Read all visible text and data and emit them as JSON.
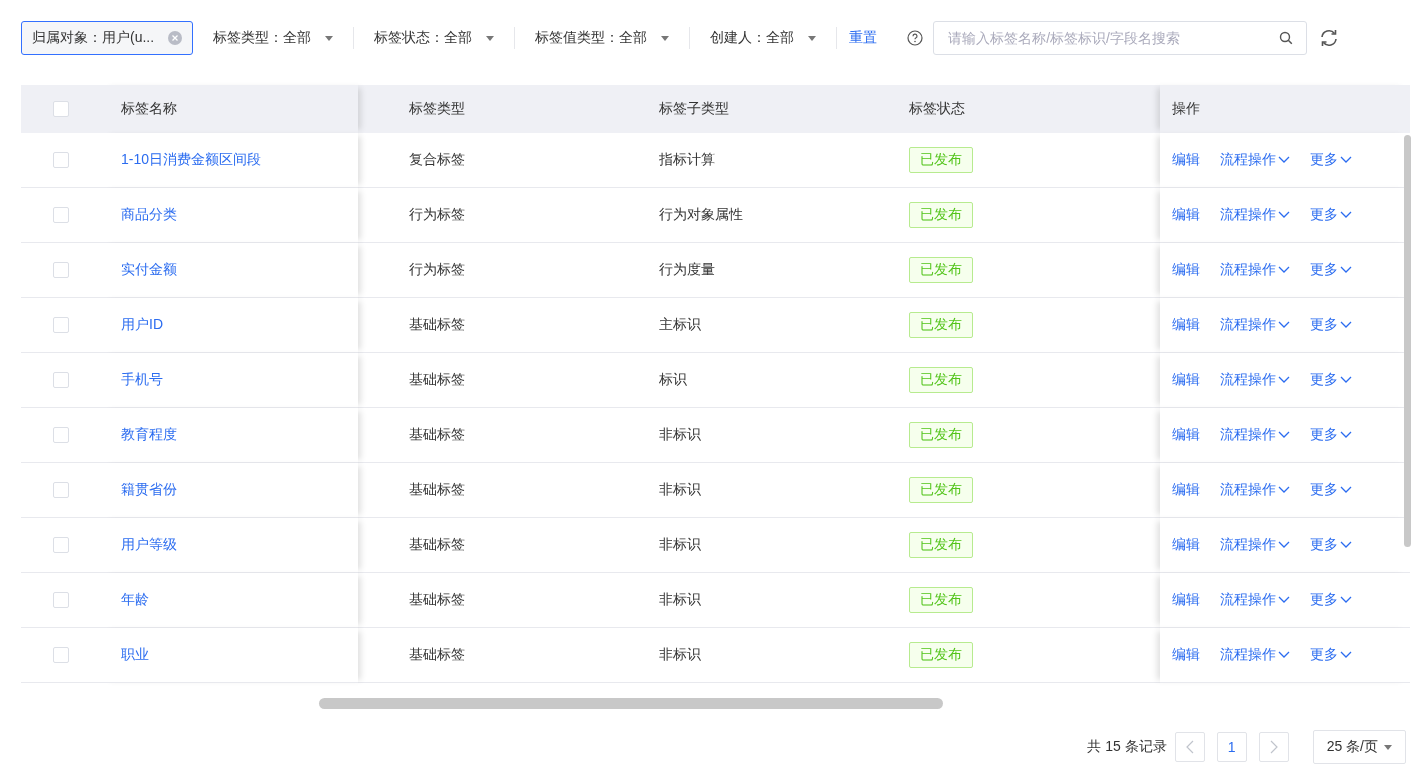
{
  "filters": {
    "owner_chip": {
      "label": "归属对象：用户(u..."
    },
    "selects": [
      {
        "label": "标签类型：全部"
      },
      {
        "label": "标签状态：全部"
      },
      {
        "label": "标签值类型：全部"
      },
      {
        "label": "创建人：全部"
      }
    ],
    "reset_link": "重置",
    "search": {
      "placeholder": "请输入标签名称/标签标识/字段名搜索"
    }
  },
  "table": {
    "header_checkbox": {
      "checked": false
    },
    "columns": [
      "标签名称",
      "标签类型",
      "标签子类型",
      "标签状态",
      "操作"
    ],
    "rows": [
      {
        "checked": false,
        "name": "1-10日消费金额区间段",
        "type": "复合标签",
        "subtype": "指标计算",
        "status": "已发布",
        "actions": [
          {
            "label": "编辑",
            "menu": false
          },
          {
            "label": "流程操作",
            "menu": true
          },
          {
            "label": "更多",
            "menu": true
          }
        ]
      },
      {
        "checked": false,
        "name": "商品分类",
        "type": "行为标签",
        "subtype": "行为对象属性",
        "status": "已发布",
        "actions": [
          {
            "label": "编辑",
            "menu": false
          },
          {
            "label": "流程操作",
            "menu": true
          },
          {
            "label": "更多",
            "menu": true
          }
        ]
      },
      {
        "checked": false,
        "name": "实付金额",
        "type": "行为标签",
        "subtype": "行为度量",
        "status": "已发布",
        "actions": [
          {
            "label": "编辑",
            "menu": false
          },
          {
            "label": "流程操作",
            "menu": true
          },
          {
            "label": "更多",
            "menu": true
          }
        ]
      },
      {
        "checked": false,
        "name": "用户ID",
        "type": "基础标签",
        "subtype": "主标识",
        "status": "已发布",
        "actions": [
          {
            "label": "编辑",
            "menu": false
          },
          {
            "label": "流程操作",
            "menu": true
          },
          {
            "label": "更多",
            "menu": true
          }
        ]
      },
      {
        "checked": false,
        "name": "手机号",
        "type": "基础标签",
        "subtype": "标识",
        "status": "已发布",
        "actions": [
          {
            "label": "编辑",
            "menu": false
          },
          {
            "label": "流程操作",
            "menu": true
          },
          {
            "label": "更多",
            "menu": true
          }
        ]
      },
      {
        "checked": false,
        "name": "教育程度",
        "type": "基础标签",
        "subtype": "非标识",
        "status": "已发布",
        "actions": [
          {
            "label": "编辑",
            "menu": false
          },
          {
            "label": "流程操作",
            "menu": true
          },
          {
            "label": "更多",
            "menu": true
          }
        ]
      },
      {
        "checked": false,
        "name": "籍贯省份",
        "type": "基础标签",
        "subtype": "非标识",
        "status": "已发布",
        "actions": [
          {
            "label": "编辑",
            "menu": false
          },
          {
            "label": "流程操作",
            "menu": true
          },
          {
            "label": "更多",
            "menu": true
          }
        ]
      },
      {
        "checked": false,
        "name": "用户等级",
        "type": "基础标签",
        "subtype": "非标识",
        "status": "已发布",
        "actions": [
          {
            "label": "编辑",
            "menu": false
          },
          {
            "label": "流程操作",
            "menu": true
          },
          {
            "label": "更多",
            "menu": true
          }
        ]
      },
      {
        "checked": false,
        "name": "年龄",
        "type": "基础标签",
        "subtype": "非标识",
        "status": "已发布",
        "actions": [
          {
            "label": "编辑",
            "menu": false
          },
          {
            "label": "流程操作",
            "menu": true
          },
          {
            "label": "更多",
            "menu": true
          }
        ]
      },
      {
        "checked": false,
        "name": "职业",
        "type": "基础标签",
        "subtype": "非标识",
        "status": "已发布",
        "actions": [
          {
            "label": "编辑",
            "menu": false
          },
          {
            "label": "流程操作",
            "menu": true
          },
          {
            "label": "更多",
            "menu": true
          }
        ]
      }
    ]
  },
  "pagination": {
    "total": "共 15 条记录",
    "prev": {
      "disabled": true
    },
    "pages": [
      {
        "label": "1",
        "selected": true
      }
    ],
    "next": {
      "disabled": true
    },
    "page_size": "25 条/页"
  }
}
